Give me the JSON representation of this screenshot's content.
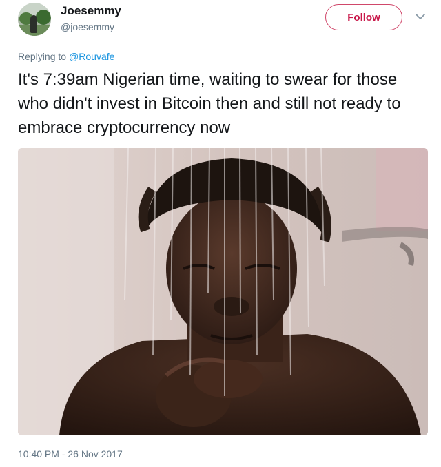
{
  "user": {
    "name": "Joesemmy",
    "handle": "@joesemmy_"
  },
  "follow_label": "Follow",
  "reply": {
    "prefix": "Replying to",
    "to": "@Rouvafe"
  },
  "tweet_text": "It's 7:39am Nigerian time, waiting to swear for those who didn't invest in Bitcoin then and still not ready to embrace cryptocurrency now",
  "timestamp": "10:40 PM - 26 Nov 2017",
  "colors": {
    "follow_accent": "#c9184a",
    "link": "#1b95e0",
    "secondary_text": "#657786"
  }
}
